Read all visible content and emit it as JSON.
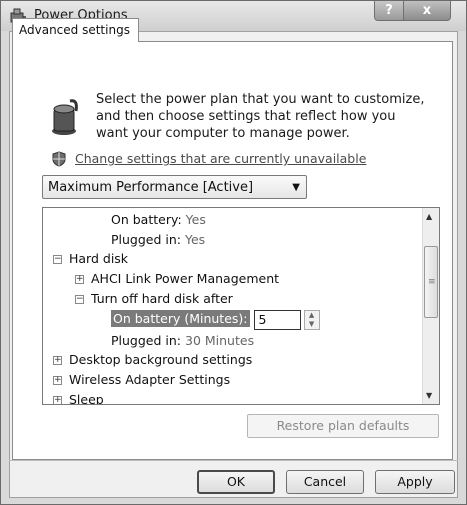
{
  "window": {
    "title": "Power Options",
    "help_label": "?",
    "close_label": "x"
  },
  "tab": {
    "label": "Advanced settings"
  },
  "intro": {
    "text": "Select the power plan that you want to customize, and then choose settings that reflect how you want your computer to manage power."
  },
  "change_link": "Change settings that are currently unavailable",
  "plan_select": {
    "value": "Maximum Performance [Active]"
  },
  "tree": {
    "rows": [
      {
        "label": "On battery:",
        "value": "Yes"
      },
      {
        "label": "Plugged in:",
        "value": "Yes"
      },
      {
        "label": "Hard disk",
        "expander": "−"
      },
      {
        "label": "AHCI Link Power Management",
        "expander": "+"
      },
      {
        "label": "Turn off hard disk after",
        "expander": "−"
      },
      {
        "label": "On battery (Minutes):",
        "value": "5"
      },
      {
        "label": "Plugged in:",
        "value": "30 Minutes"
      },
      {
        "label": "Desktop background settings",
        "expander": "+"
      },
      {
        "label": "Wireless Adapter Settings",
        "expander": "+"
      },
      {
        "label": "Sleep",
        "expander": "+"
      }
    ]
  },
  "buttons": {
    "restore": "Restore plan defaults",
    "ok": "OK",
    "cancel": "Cancel",
    "apply": "Apply"
  },
  "icons": {
    "title": "power-options-icon",
    "plan": "power-plan-icon",
    "shield": "shield-icon"
  }
}
